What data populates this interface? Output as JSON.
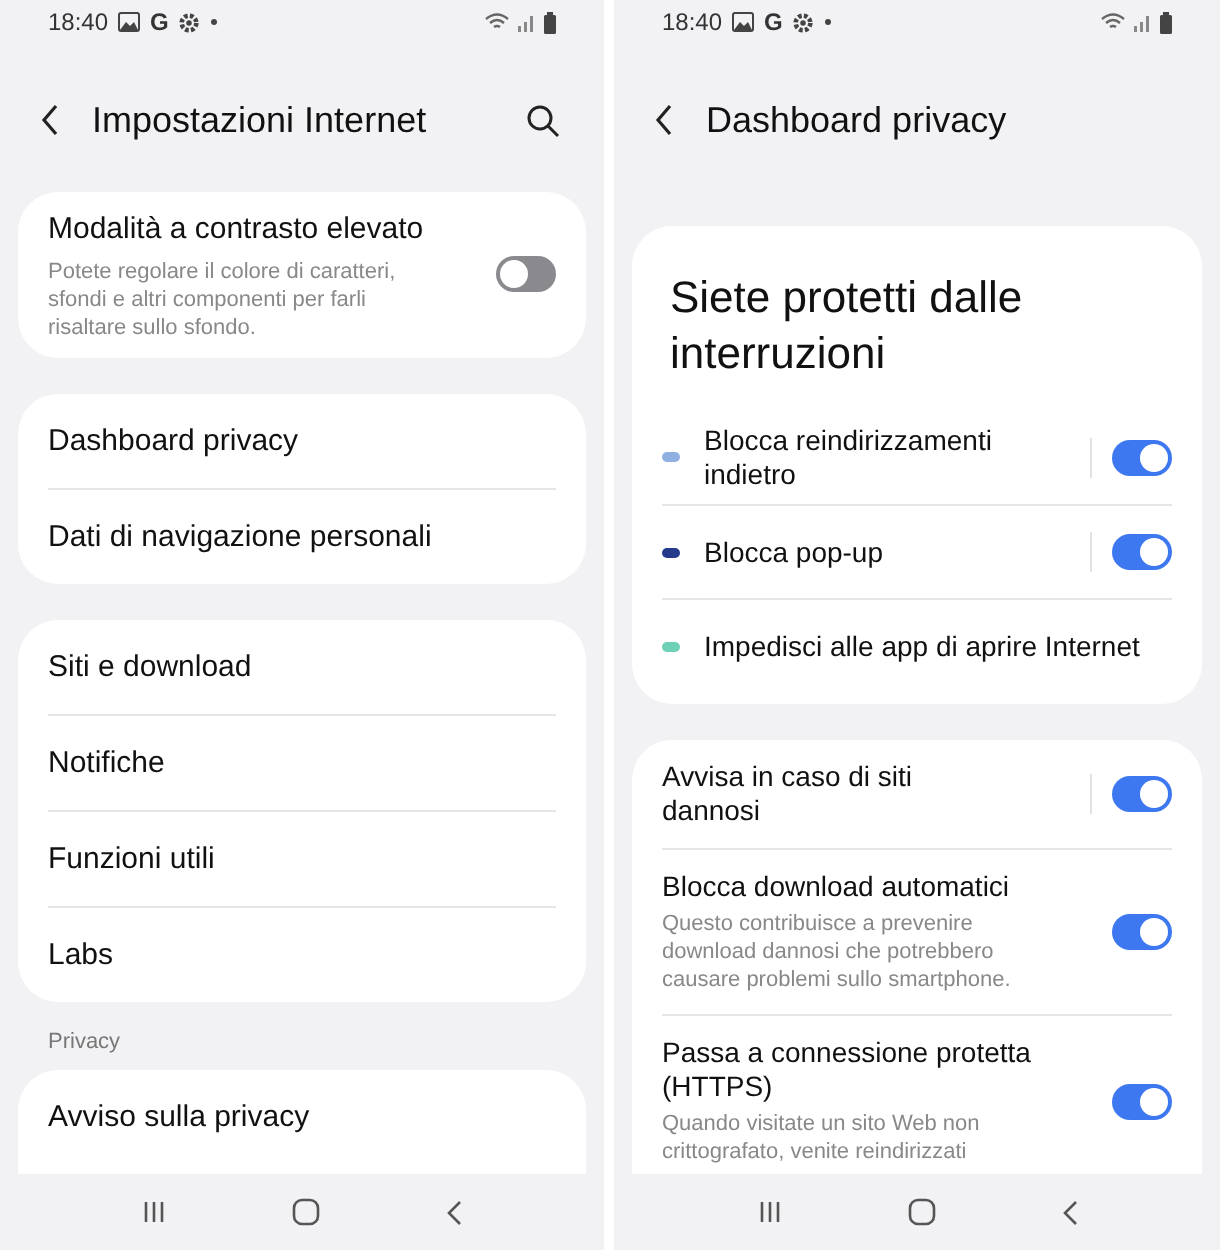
{
  "left": {
    "status": {
      "time": "18:40",
      "g": "G"
    },
    "title": "Impostazioni Internet",
    "groups": [
      {
        "items": [
          {
            "kind": "toggle",
            "label": "Modalità a contrasto elevato",
            "description": "Potete regolare il colore di caratteri, sfondi e altri componenti per farli risaltare sullo sfondo.",
            "on": false
          }
        ]
      },
      {
        "items": [
          {
            "kind": "link",
            "label": "Dashboard privacy"
          },
          {
            "kind": "link",
            "label": "Dati di navigazione personali"
          }
        ]
      },
      {
        "items": [
          {
            "kind": "link",
            "label": "Siti e download"
          },
          {
            "kind": "link",
            "label": "Notifiche"
          },
          {
            "kind": "link",
            "label": "Funzioni utili"
          },
          {
            "kind": "link",
            "label": "Labs"
          }
        ]
      },
      {
        "heading": "Privacy",
        "items": [
          {
            "kind": "link",
            "label": "Avviso sulla privacy"
          }
        ]
      }
    ]
  },
  "right": {
    "status": {
      "time": "18:40",
      "g": "G"
    },
    "title": "Dashboard privacy",
    "summary": {
      "heading": "Siete protetti dalle interruzioni",
      "items": [
        {
          "kind": "toggle",
          "label": "Blocca reindirizzamenti indietro",
          "color": "#8fb0e0",
          "on": true
        },
        {
          "kind": "toggle",
          "label": "Blocca pop-up",
          "color": "#243a8a",
          "on": true
        },
        {
          "kind": "plain",
          "label": "Impedisci alle app di aprire Internet",
          "color": "#6fd0b8"
        }
      ]
    },
    "settings": [
      {
        "label": "Avvisa in caso di siti dannosi",
        "on": true,
        "split": true
      },
      {
        "label": "Blocca download automatici",
        "description": "Questo contribuisce a prevenire download dannosi che potrebbero causare problemi sullo smartphone.",
        "on": true,
        "split": false
      },
      {
        "label": "Passa a connessione protetta (HTTPS)",
        "description": "Quando visitate un sito Web non crittografato, venite reindirizzati",
        "on": true,
        "split": false
      }
    ]
  }
}
